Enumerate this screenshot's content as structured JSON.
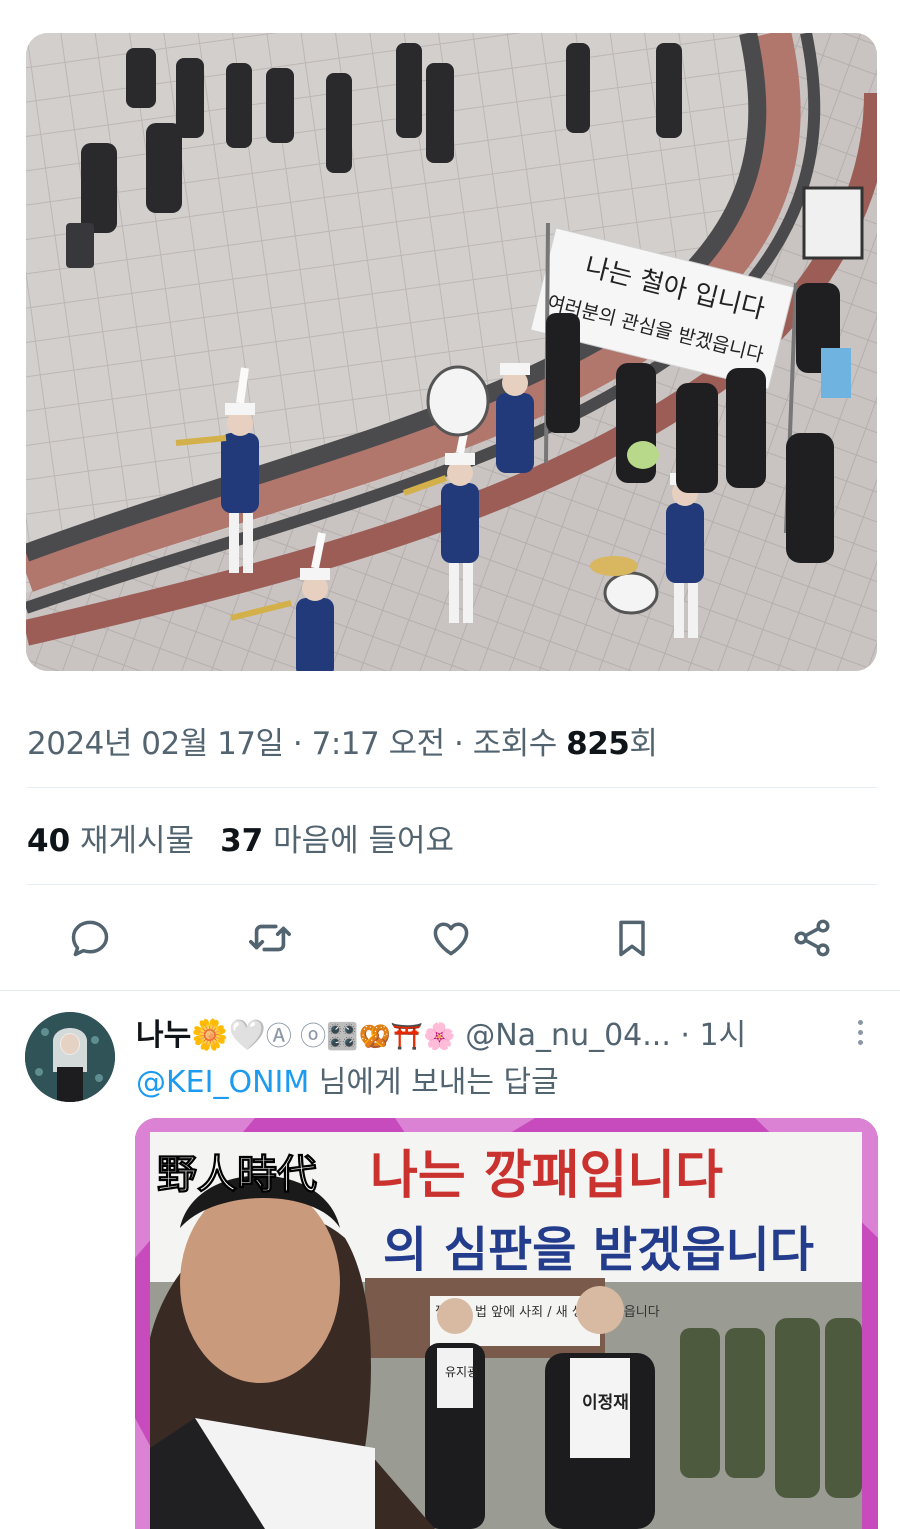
{
  "tweet": {
    "photo_banner_line1": "나는 철아 입니다",
    "photo_banner_line2": "여러분의 관심을 받겠읍니다",
    "date": "2024년 02월 17일",
    "sep": " · ",
    "time": "7:17 오전",
    "views_label": "조회수 ",
    "views_count": "825",
    "views_suffix": "회",
    "reposts_count": "40",
    "reposts_label": " 재게시물",
    "likes_count": "37",
    "likes_label": " 마음에 들어요"
  },
  "actions": [
    {
      "icon": "reply-icon"
    },
    {
      "icon": "repost-icon"
    },
    {
      "icon": "like-icon"
    },
    {
      "icon": "bookmark-icon"
    },
    {
      "icon": "share-icon"
    }
  ],
  "reply": {
    "display_name": "나누🌼🤍",
    "name_extra": "Ⓐ ⓞ🎛️🥨⛩️🌸",
    "handle": "@Na_nu_04...",
    "time": " · 1시",
    "replying_mention": "@KEI_ONIM",
    "replying_text": " 님에게 보내는 답글",
    "media": {
      "logo": "野人時代",
      "banner_line1": "나는 깡패입니다",
      "banner_line2": "의 심판을 받겠읍니다",
      "sign_small": "깡패는 법 앞에 사죄 / 새 생활 하겠읍니다",
      "name_tag_left": "유지광",
      "name_tag_right": "이정재"
    }
  },
  "colors": {
    "text_primary": "#0f1419",
    "text_secondary": "#536471",
    "link": "#1d9bf0",
    "divider": "#e6ecf0"
  }
}
